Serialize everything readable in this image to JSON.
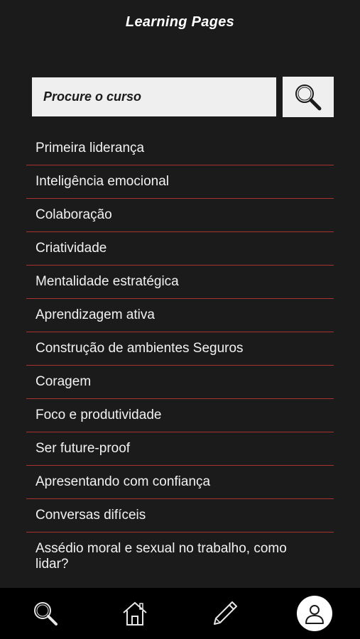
{
  "header": {
    "title": "Learning Pages"
  },
  "search": {
    "placeholder": "Procure o curso"
  },
  "courses": [
    "Primeira liderança",
    "Inteligência emocional",
    "Colaboração",
    "Criatividade",
    "Mentalidade estratégica",
    "Aprendizagem ativa",
    "Construção de ambientes Seguros",
    "Coragem",
    "Foco e produtividade",
    "Ser future-proof",
    "Apresentando com confiança",
    "Conversas difíceis",
    "Assédio moral e sexual no trabalho, como lidar?"
  ],
  "bottom_nav": {
    "icons": [
      "search-icon",
      "home-icon",
      "pencil-icon",
      "user-icon"
    ]
  },
  "colors": {
    "background": "#1b1b1b",
    "divider": "#a8322d",
    "nav_background": "#000000",
    "input_background": "#efefef"
  }
}
